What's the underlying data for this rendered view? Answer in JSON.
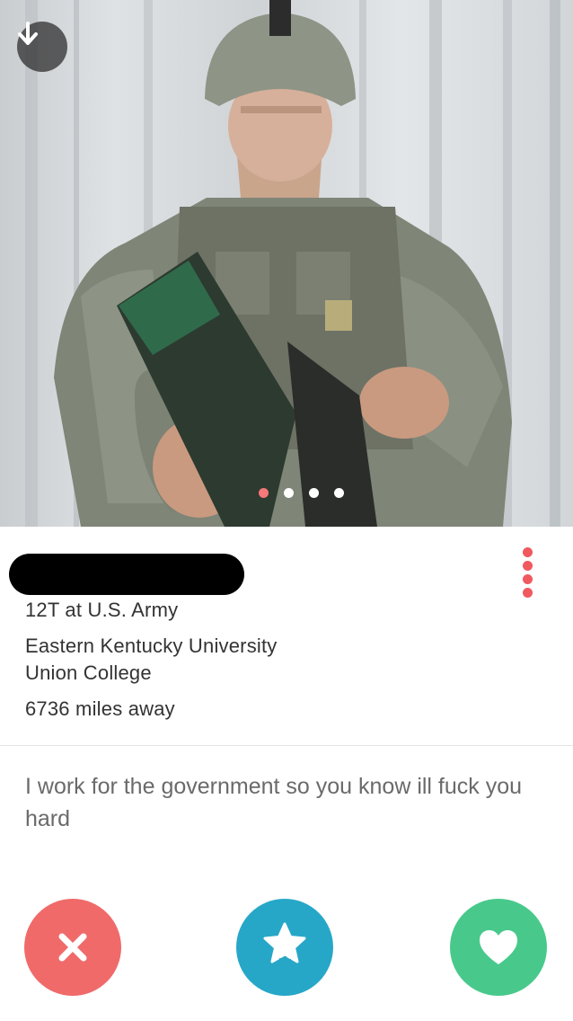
{
  "profile": {
    "job": "12T at U.S. Army",
    "school_1": "Eastern Kentucky University",
    "school_2": "Union College",
    "distance": "6736 miles away",
    "bio": "I work for the government so you know ill fuck you hard"
  },
  "photo": {
    "photo_count": 4,
    "current_photo": 1
  },
  "colors": {
    "active_dot": "#f5787a",
    "menu_dots": "#f0595f",
    "nope": "#f06a6a",
    "superlike": "#27a7c8",
    "like": "#48c98b"
  },
  "icons": {
    "back": "arrow-down-icon",
    "menu": "vertical-dots-icon",
    "nope": "x-icon",
    "superlike": "star-icon",
    "like": "heart-icon"
  }
}
